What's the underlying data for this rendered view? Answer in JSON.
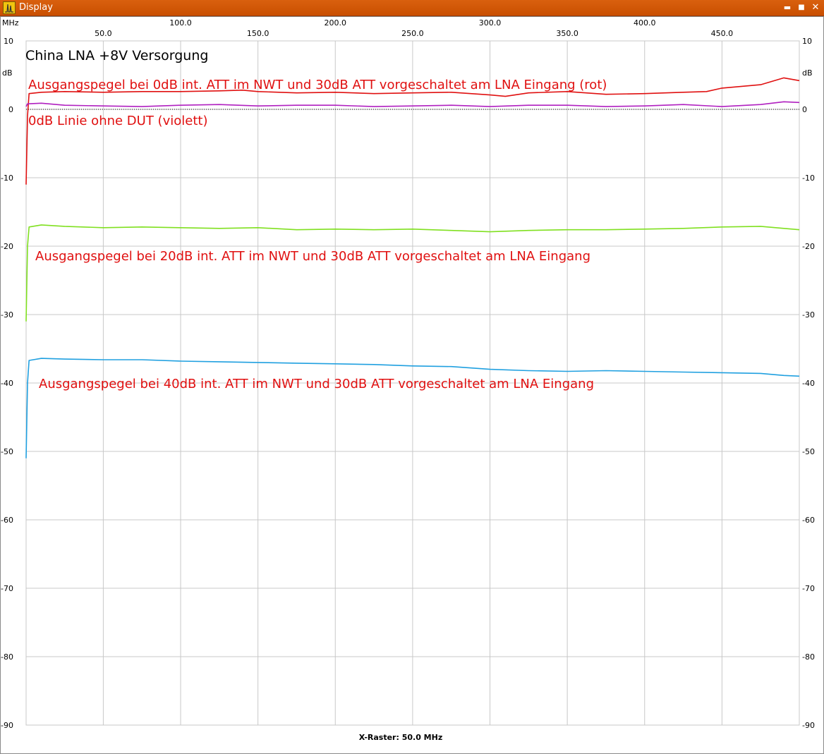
{
  "window": {
    "title": "Display",
    "icon": "spectrum-app-icon",
    "controls": [
      "minimize-icon",
      "maximize-icon",
      "close-icon"
    ]
  },
  "colors": {
    "titlebar": "#d35400",
    "grid": "#c8c8c8",
    "red": "#e01010",
    "violet": "#b020c0",
    "green": "#80e020",
    "blue": "#20a0e0",
    "annotation": "#e01010"
  },
  "chart_data": {
    "type": "line",
    "title": "China LNA +8V Versorgung",
    "x_unit": "MHz",
    "y_unit": "dB",
    "xlim": [
      0.1,
      500
    ],
    "ylim": [
      -90,
      10
    ],
    "x_ticks": [
      50,
      100,
      150,
      200,
      250,
      300,
      350,
      400,
      450
    ],
    "x_tick_labels": [
      "50.0",
      "100.0",
      "150.0",
      "200.0",
      "250.0",
      "300.0",
      "350.0",
      "400.0",
      "450.0"
    ],
    "y_ticks": [
      10,
      0,
      -10,
      -20,
      -30,
      -40,
      -50,
      -60,
      -70,
      -80,
      -90
    ],
    "y_tick_labels": [
      "10",
      "0",
      "-10",
      "-20",
      "-30",
      "-40",
      "-50",
      "-60",
      "-70",
      "-80",
      "-90"
    ],
    "grid": true,
    "x_raster_label": "X-Raster: 50.0 MHz",
    "annotations": [
      "Ausgangspegel bei 0dB int. ATT im NWT und 30dB ATT vorgeschaltet am LNA Eingang (rot)",
      "0dB Linie ohne DUT (violett)",
      "Ausgangspegel bei 20dB int. ATT im NWT und 30dB ATT vorgeschaltet am LNA Eingang",
      "Ausgangspegel bei 40dB int. ATT im NWT und 30dB ATT vorgeschaltet am LNA Eingang"
    ],
    "series": [
      {
        "color": "#e01010",
        "x": [
          0.1,
          1,
          2,
          10,
          25,
          50,
          75,
          100,
          125,
          140,
          150,
          175,
          200,
          225,
          250,
          275,
          300,
          310,
          325,
          350,
          375,
          400,
          425,
          440,
          450,
          475,
          490,
          500
        ],
        "y": [
          -11,
          -1,
          2.3,
          2.5,
          2.6,
          2.5,
          2.6,
          2.6,
          2.7,
          2.8,
          2.6,
          2.4,
          2.5,
          2.3,
          2.4,
          2.5,
          2.1,
          1.9,
          2.4,
          2.6,
          2.2,
          2.3,
          2.5,
          2.6,
          3.1,
          3.6,
          4.6,
          4.2
        ]
      },
      {
        "color": "#b020c0",
        "x": [
          0.1,
          1,
          10,
          25,
          50,
          75,
          100,
          125,
          150,
          175,
          200,
          225,
          250,
          275,
          300,
          325,
          350,
          375,
          400,
          425,
          450,
          475,
          490,
          500
        ],
        "y": [
          0.4,
          0.8,
          0.9,
          0.6,
          0.5,
          0.4,
          0.6,
          0.7,
          0.5,
          0.6,
          0.6,
          0.4,
          0.5,
          0.6,
          0.4,
          0.6,
          0.6,
          0.4,
          0.5,
          0.7,
          0.4,
          0.7,
          1.1,
          1.0
        ]
      },
      {
        "color": "#80e020",
        "x": [
          0.1,
          1,
          2,
          10,
          25,
          50,
          75,
          100,
          125,
          150,
          175,
          200,
          225,
          250,
          275,
          300,
          325,
          350,
          375,
          400,
          425,
          450,
          475,
          490,
          500
        ],
        "y": [
          -31,
          -20,
          -17.2,
          -16.9,
          -17.1,
          -17.3,
          -17.2,
          -17.3,
          -17.4,
          -17.3,
          -17.6,
          -17.5,
          -17.6,
          -17.5,
          -17.7,
          -17.9,
          -17.7,
          -17.6,
          -17.6,
          -17.5,
          -17.4,
          -17.2,
          -17.1,
          -17.4,
          -17.6
        ]
      },
      {
        "color": "#20a0e0",
        "x": [
          0.1,
          1,
          2,
          10,
          25,
          50,
          75,
          100,
          125,
          150,
          175,
          200,
          225,
          250,
          275,
          300,
          325,
          350,
          375,
          400,
          425,
          450,
          475,
          490,
          500
        ],
        "y": [
          -51,
          -40,
          -36.7,
          -36.4,
          -36.5,
          -36.6,
          -36.6,
          -36.8,
          -36.9,
          -37.0,
          -37.1,
          -37.2,
          -37.3,
          -37.5,
          -37.6,
          -38.0,
          -38.2,
          -38.3,
          -38.2,
          -38.3,
          -38.4,
          -38.5,
          -38.6,
          -38.9,
          -39.0
        ]
      }
    ]
  }
}
